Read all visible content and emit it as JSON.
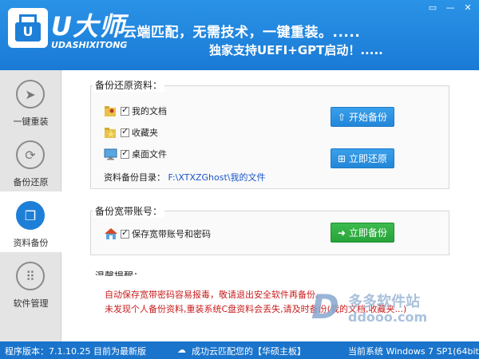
{
  "header": {
    "logo_title": "U大师",
    "logo_sub": "UDASHIXITONG",
    "logo_glyph": "U",
    "slogan1": "云端匹配，无需技术，一键重装。.....",
    "slogan2": "独家支持UEFI+GPT启动！.....",
    "window_buttons": [
      "▭",
      "—",
      "✕"
    ]
  },
  "sidebar": {
    "items": [
      {
        "label": "一键重装",
        "icon": "cursor-icon",
        "glyph": "➤"
      },
      {
        "label": "备份还原",
        "icon": "refresh-icon",
        "glyph": "⟳"
      },
      {
        "label": "资料备份",
        "icon": "copy-icon",
        "glyph": "❐"
      },
      {
        "label": "软件管理",
        "icon": "grid-icon",
        "glyph": "⠿"
      }
    ]
  },
  "backup": {
    "title": "备份还原资料：",
    "items": [
      "我的文档",
      "收藏夹",
      "桌面文件"
    ],
    "start_button": "开始备份",
    "restore_button": "立即还原",
    "dir_label": "资料备份目录：",
    "dir_value": "F:\\XTXZGhost\\我的文件"
  },
  "broadband": {
    "title": "备份宽带账号：",
    "item": "保存宽带账号和密码",
    "button": "立即备份"
  },
  "notice": {
    "title": "温馨提醒：",
    "line1": "自动保存宽带密码容易报毒，敬请退出安全软件再备份。",
    "line2": "未发现个人备份资料,重装系统C盘资料会丢失,请及时备份(我的文档,收藏夹...)"
  },
  "status": {
    "version": "程序版本：7.1.10.25 目前为最新版",
    "cloud": "成功云匹配您的【华硕主板】",
    "system": "当前系统 Windows 7 SP1(64bit)"
  },
  "watermark": {
    "letter": "D",
    "text1": "多多软件站",
    "text2": "ddooo.com"
  },
  "colors": {
    "accent": "#1d7fd8",
    "green": "#27a33a",
    "warning": "#c81d1d",
    "link": "#1a56c8"
  }
}
